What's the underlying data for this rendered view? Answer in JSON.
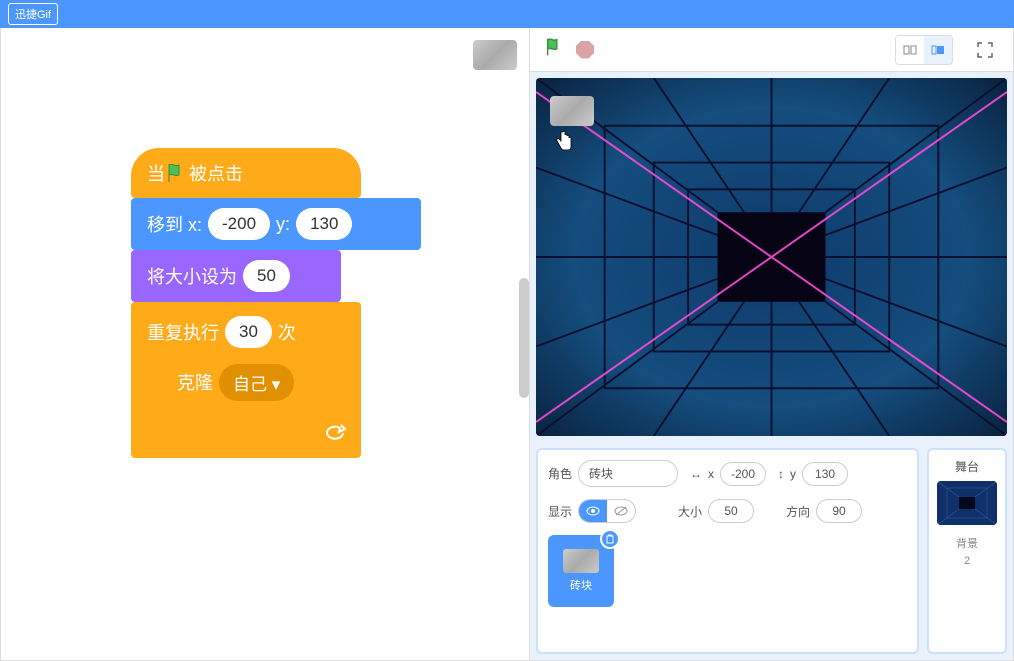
{
  "titlebar": {
    "badge": "迅捷Gif"
  },
  "blocks": {
    "hat": {
      "prefix": "当",
      "suffix": "被点击"
    },
    "goto": {
      "label_prefix": "移到 x:",
      "x": "-200",
      "y_label": "y:",
      "y": "130"
    },
    "size": {
      "label": "将大小设为",
      "value": "50"
    },
    "repeat": {
      "label": "重复执行",
      "times": "30",
      "suffix": "次"
    },
    "clone": {
      "label": "克隆",
      "target": "自己"
    }
  },
  "sprite_info": {
    "name_label": "角色",
    "name": "砖块",
    "x_label": "x",
    "x": "-200",
    "y_label": "y",
    "y": "130",
    "show_label": "显示",
    "size_label": "大小",
    "size": "50",
    "dir_label": "方向",
    "dir": "90"
  },
  "sprite_card": {
    "label": "砖块"
  },
  "stage_panel": {
    "title": "舞台",
    "bg_label": "背景",
    "bg_count": "2"
  }
}
